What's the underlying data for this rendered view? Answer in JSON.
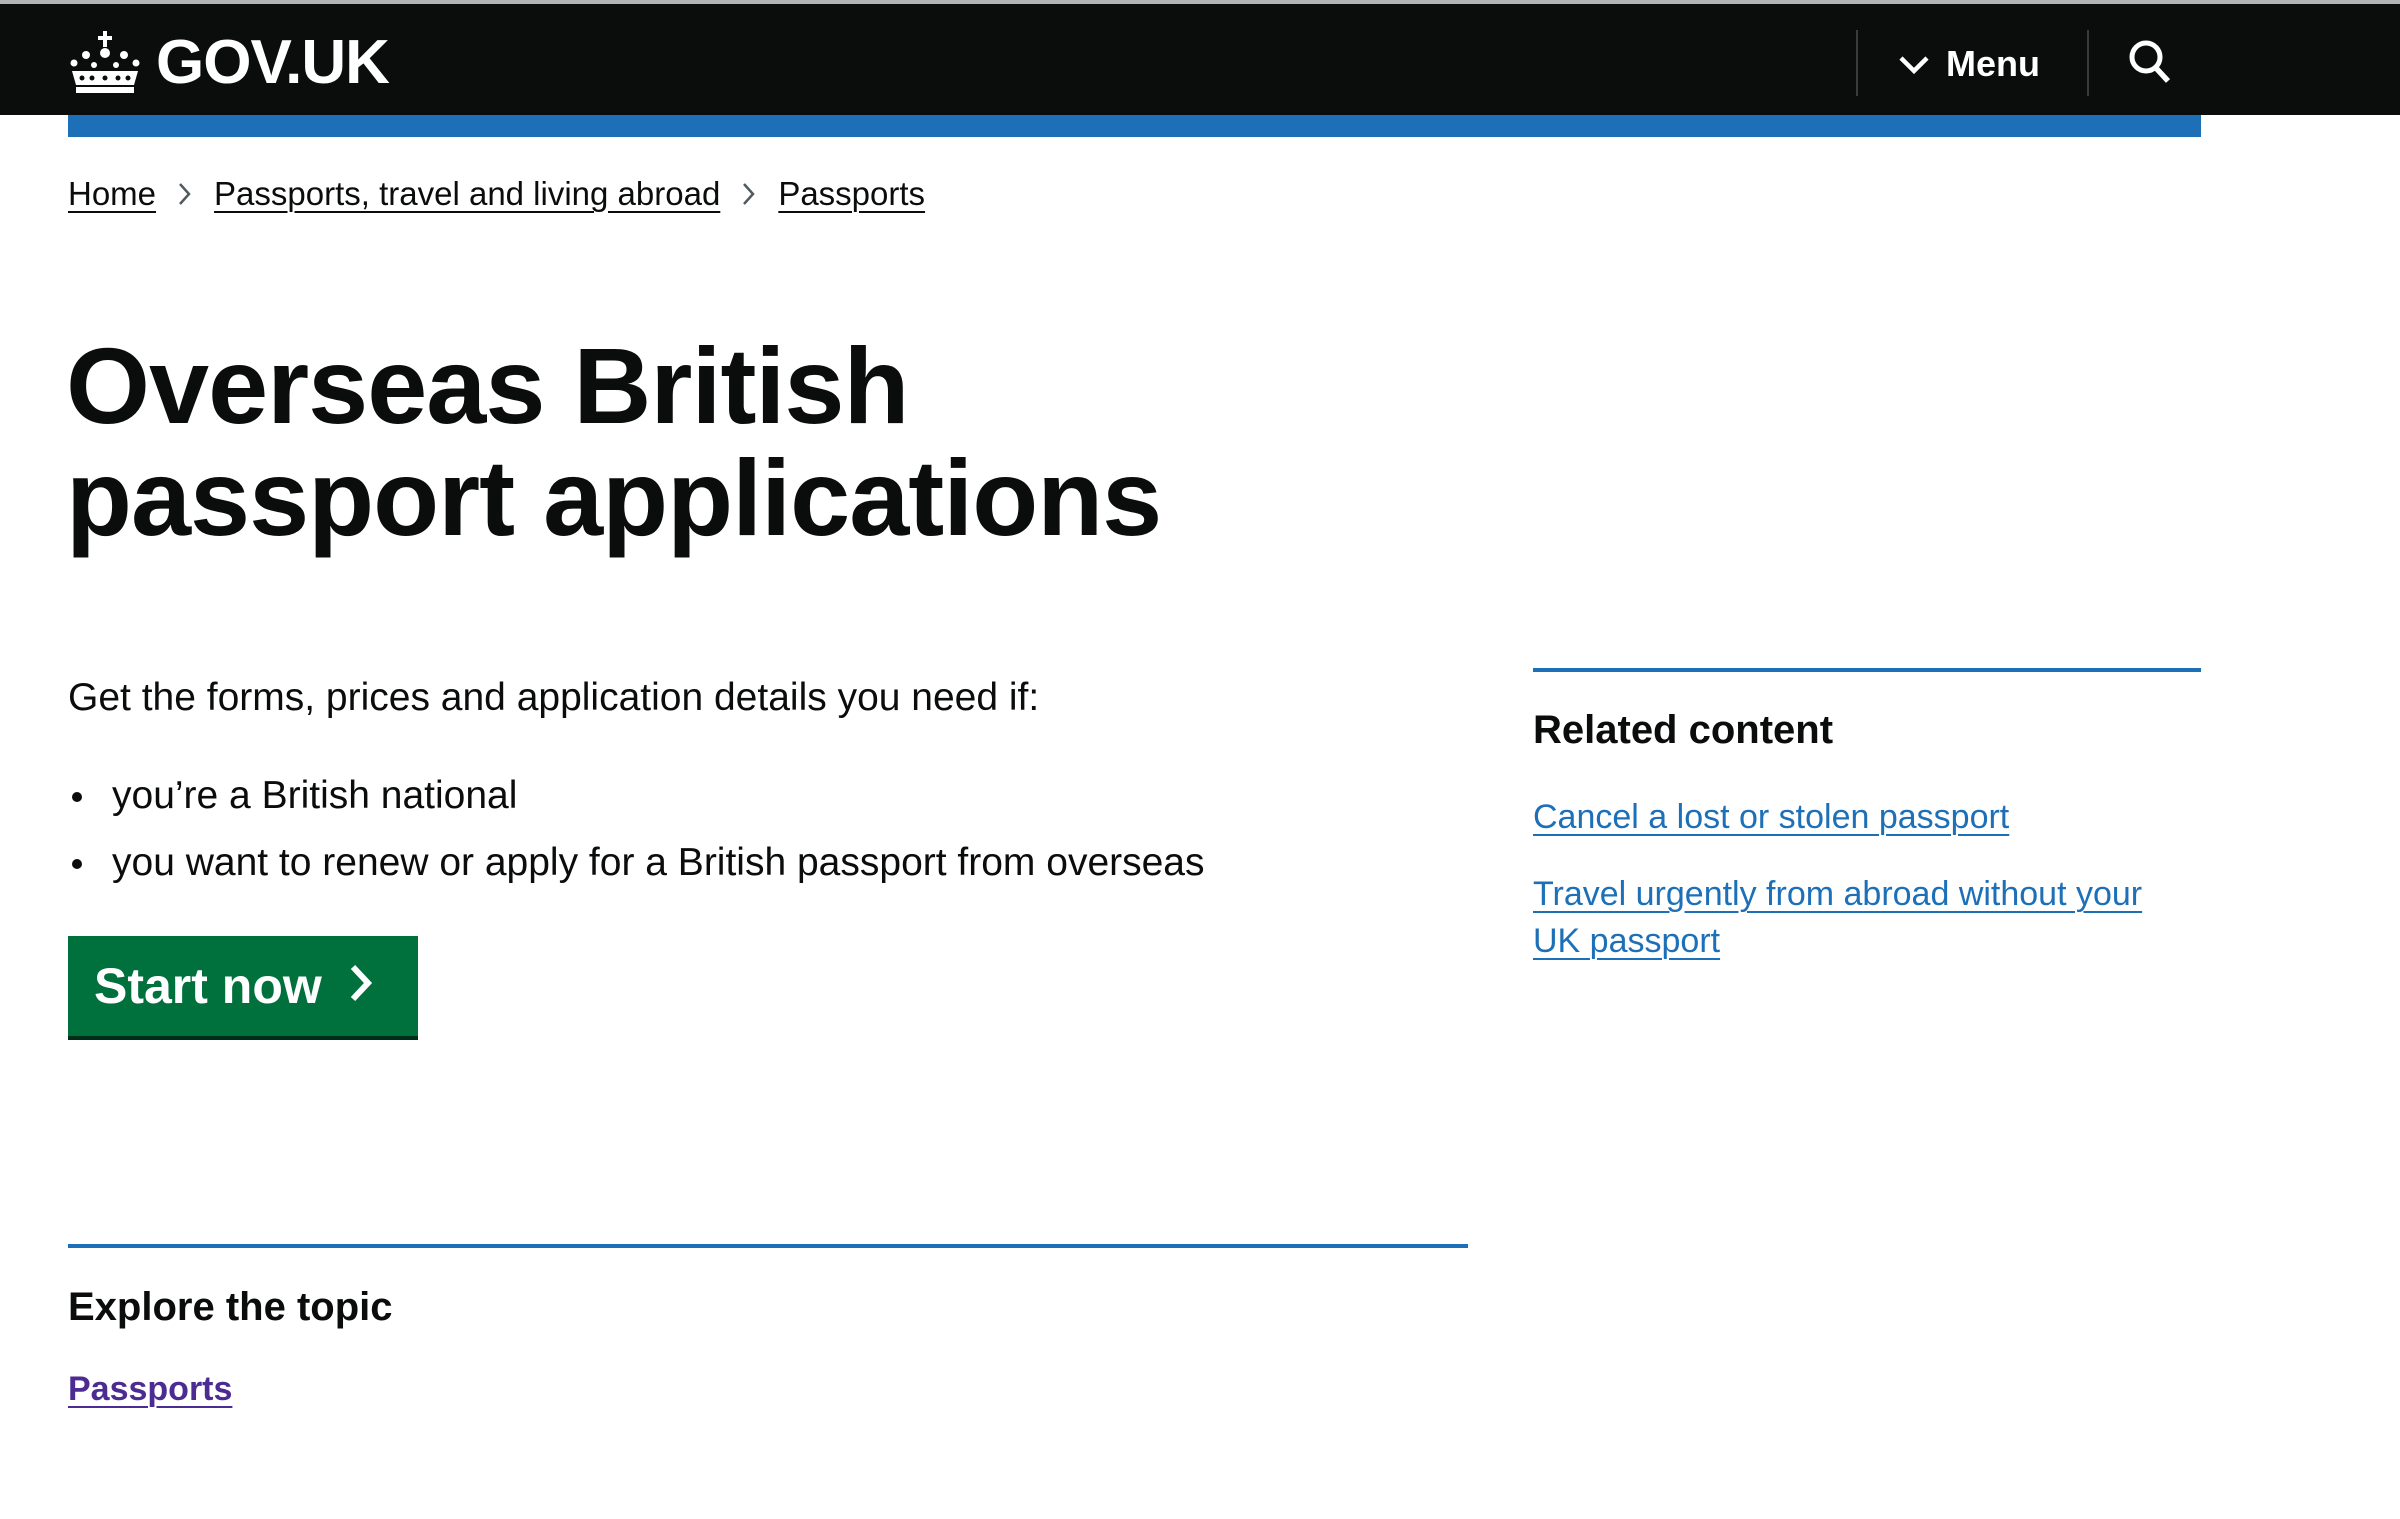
{
  "header": {
    "logo_text": "GOV.UK",
    "menu_label": "Menu"
  },
  "breadcrumb": {
    "items": [
      "Home",
      "Passports, travel and living abroad",
      "Passports"
    ]
  },
  "main": {
    "title": "Overseas British passport applications",
    "intro": "Get the forms, prices and application details you need if:",
    "bullets": [
      "you’re a British national",
      "you want to renew or apply for a British passport from overseas"
    ],
    "start_button": "Start now"
  },
  "related": {
    "heading": "Related content",
    "links": [
      "Cancel a lost or stolen passport",
      "Travel urgently from abroad without your UK passport"
    ]
  },
  "explore": {
    "heading": "Explore the topic",
    "link": "Passports"
  },
  "colors": {
    "header_bg": "#0b0c0c",
    "brand_blue": "#1d70b8",
    "button_green": "#00703c",
    "visited_link": "#4c2c92"
  },
  "icons": [
    "crown-icon",
    "chevron-down-icon",
    "search-icon",
    "breadcrumb-chevron-icon",
    "arrow-right-icon"
  ]
}
